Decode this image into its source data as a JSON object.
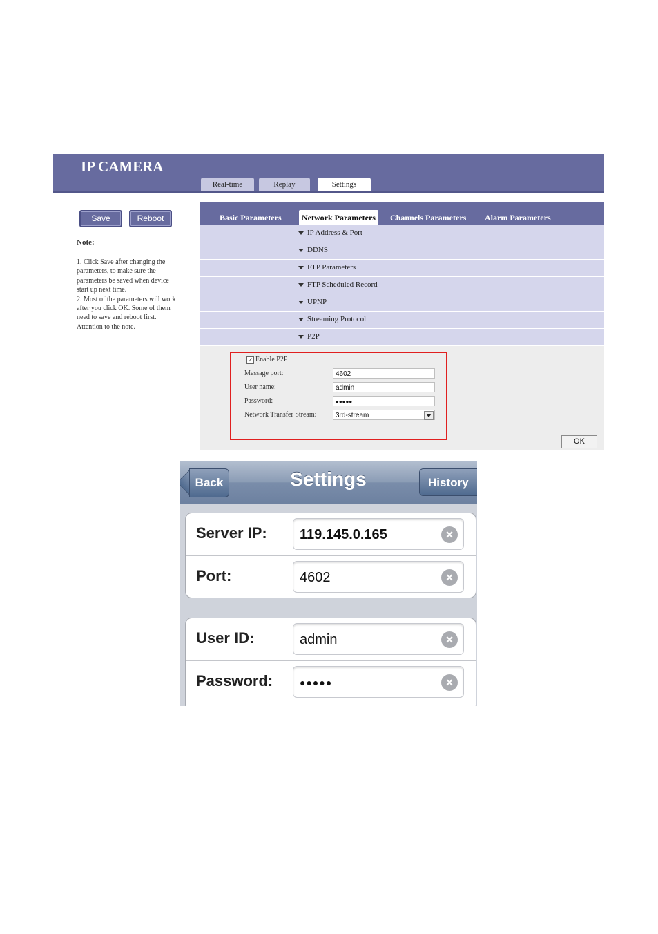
{
  "web": {
    "title": "IP CAMERA",
    "top_tabs": [
      "Real-time",
      "Replay",
      "Settings"
    ],
    "active_top_tab": "Settings",
    "buttons": {
      "save": "Save",
      "reboot": "Reboot",
      "ok": "OK"
    },
    "note_title": "Note:",
    "note_text": "1. Click Save after changing the parameters, to make sure the parameters be saved when device start up next time.\n2. Most of the parameters will work after you click OK. Some of them need to save and reboot first. Attention to the note.",
    "sub_tabs": [
      "Basic Parameters",
      "Network Parameters",
      "Channels Parameters",
      "Alarm Parameters"
    ],
    "active_sub_tab": "Network Parameters",
    "sections": [
      "IP Address & Port",
      "DDNS",
      "FTP Parameters",
      "FTP Scheduled Record",
      "UPNP",
      "Streaming Protocol",
      "P2P"
    ],
    "p2p": {
      "enable_label": "Enable P2P",
      "enabled": true,
      "message_port_label": "Message port:",
      "message_port": "4602",
      "user_name_label": "User name:",
      "user_name": "admin",
      "password_label": "Password:",
      "password": "●●●●●",
      "stream_label": "Network Transfer Stream:",
      "stream": "3rd-stream"
    },
    "colors": {
      "header": "#676b9f",
      "section_row": "#d5d6ec",
      "highlight_box": "#e02020"
    }
  },
  "phone": {
    "title": "Settings",
    "back": "Back",
    "history": "History",
    "fields": [
      {
        "label": "Server IP:",
        "value": "119.145.0.165"
      },
      {
        "label": "Port:",
        "value": "4602"
      },
      {
        "label": "User ID:",
        "value": "admin"
      },
      {
        "label": "Password:",
        "value": "●●●●●"
      }
    ],
    "clear_icon": "clear-x-icon"
  }
}
